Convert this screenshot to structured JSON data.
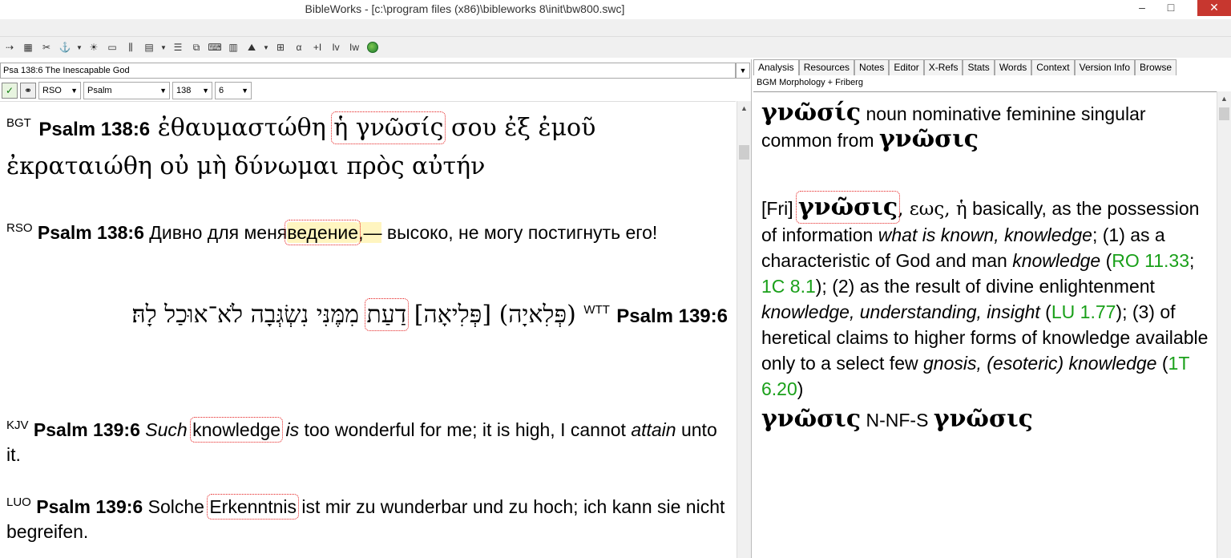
{
  "window": {
    "title": "BibleWorks - [c:\\program files (x86)\\bibleworks 8\\init\\bw800.swc]",
    "minimize": "–",
    "maximize": "□",
    "close": "✕"
  },
  "toolbar": {
    "icons": [
      "toolbar-icon-1",
      "toolbar-icon-2",
      "toolbar-icon-3",
      "toolbar-icon-4",
      "toolbar-icon-5",
      "toolbar-icon-6",
      "toolbar-icon-7",
      "toolbar-icon-8",
      "toolbar-icon-9",
      "toolbar-icon-10",
      "toolbar-icon-11",
      "toolbar-icon-12",
      "toolbar-icon-13",
      "toolbar-icon-14",
      "toolbar-icon-15",
      "toolbar-icon-16",
      "toolbar-icon-17",
      "globe-icon"
    ],
    "glyphs": {
      "ia": "Iv",
      "iw": "Iw",
      "plus": "+I"
    }
  },
  "left": {
    "verse_title": "Psa 138:6 The Inescapable God",
    "version_select": "RSO",
    "book_select": "Psalm",
    "chapter_select": "138",
    "verse_select": "6",
    "verses": {
      "bgt": {
        "version": "BGT",
        "ref": "Psalm 138:6",
        "pre": "ἐθαυμαστώθη",
        "highlight": "ἡ γνῶσίς",
        "post": "σου ἐξ ἐμοῦ ἐκραταιώθη οὐ μὴ δύνωμαι πρὸς αὐτήν"
      },
      "rso": {
        "version": "RSO",
        "ref": "Psalm 138:6",
        "pre": "Дивно для меня",
        "highlight": "ведение",
        "dash": ",—",
        "post": "высоко, не могу постигнуть его!"
      },
      "wtt": {
        "version": "WTT",
        "ref": "Psalm 139:6",
        "pre": "(פְּלִאיָה) [פְּלִיאָה]",
        "highlight": "דַעַת",
        "post": "מִמֶּנִּי נִשְׂגְּבָה לֹא־אוּכַל לָהּ׃"
      },
      "kjv": {
        "version": "KJV",
        "ref": "Psalm 139:6",
        "italic1": "Such",
        "highlight": "knowledge",
        "italic2": "is",
        "mid": "too wonderful for me; it is high, I cannot",
        "italic3": "attain",
        "post": "unto it."
      },
      "luo": {
        "version": "LUO",
        "ref": "Psalm 139:6",
        "pre": "Solche",
        "highlight": "Erkenntnis",
        "post": "ist mir zu wunderbar und zu hoch; ich kann sie nicht begreifen."
      }
    }
  },
  "right": {
    "tabs": [
      "Analysis",
      "Resources",
      "Notes",
      "Editor",
      "X-Refs",
      "Stats",
      "Words",
      "Context",
      "Version Info",
      "Browse"
    ],
    "sub_label": "BGM Morphology + Friberg",
    "morph": {
      "word": "γνῶσίς",
      "desc": "noun nominative feminine singular common from",
      "lemma": "γνῶσις"
    },
    "friberg": {
      "tag": "[Fri]",
      "lemma": "γνῶσις",
      "gen": ", εως, ἡ",
      "t1": "basically, as the possession of information",
      "i1": "what is known, knowledge",
      "t2": "; (1) as a characteristic of God and man",
      "i2": "knowledge",
      "r1": "RO 11.33",
      "sep1": ";",
      "r2": "1C 8.1",
      "t3": "); (2) as the result of divine enlightenment",
      "i3": "knowledge, understanding, insight",
      "r3": "LU 1.77",
      "t4": "); (3) of heretical claims to higher forms of knowledge available only to a select few",
      "i4": "gnosis, (esoteric) knowledge",
      "r4": "1T 6.20"
    },
    "summary": {
      "word": "γνῶσις",
      "code": "N-NF-S",
      "lemma": "γνῶσις"
    }
  }
}
